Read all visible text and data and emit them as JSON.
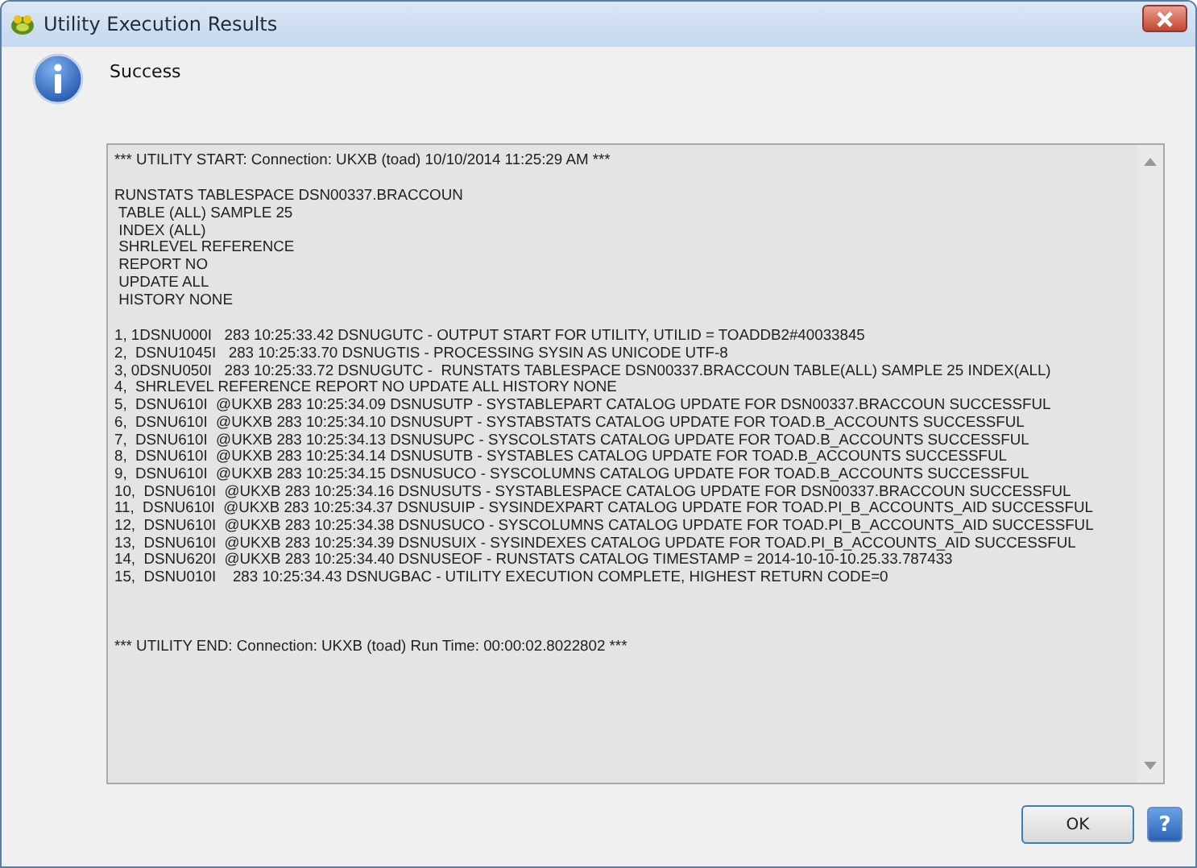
{
  "window": {
    "title": "Utility Execution Results"
  },
  "message": "Success",
  "log": {
    "blocks": [
      {
        "kind": "header",
        "lines": [
          "*** UTILITY START: Connection: UKXB (toad) 10/10/2014 11:25:29 AM ***"
        ]
      },
      {
        "kind": "script",
        "lines": [
          "RUNSTATS TABLESPACE DSN00337.BRACCOUN",
          " TABLE (ALL) SAMPLE 25",
          " INDEX (ALL)",
          " SHRLEVEL REFERENCE",
          " REPORT NO",
          " UPDATE ALL",
          " HISTORY NONE"
        ]
      },
      {
        "kind": "messages",
        "lines": [
          "1, 1DSNU000I   283 10:25:33.42 DSNUGUTC - OUTPUT START FOR UTILITY, UTILID = TOADDB2#40033845",
          "2,  DSNU1045I   283 10:25:33.70 DSNUGTIS - PROCESSING SYSIN AS UNICODE UTF-8",
          "3, 0DSNU050I   283 10:25:33.72 DSNUGUTC -  RUNSTATS TABLESPACE DSN00337.BRACCOUN TABLE(ALL) SAMPLE 25 INDEX(ALL)",
          "4,  SHRLEVEL REFERENCE REPORT NO UPDATE ALL HISTORY NONE",
          "5,  DSNU610I  @UKXB 283 10:25:34.09 DSNUSUTP - SYSTABLEPART CATALOG UPDATE FOR DSN00337.BRACCOUN SUCCESSFUL",
          "6,  DSNU610I  @UKXB 283 10:25:34.10 DSNUSUPT - SYSTABSTATS CATALOG UPDATE FOR TOAD.B_ACCOUNTS SUCCESSFUL",
          "7,  DSNU610I  @UKXB 283 10:25:34.13 DSNUSUPC - SYSCOLSTATS CATALOG UPDATE FOR TOAD.B_ACCOUNTS SUCCESSFUL",
          "8,  DSNU610I  @UKXB 283 10:25:34.14 DSNUSUTB - SYSTABLES CATALOG UPDATE FOR TOAD.B_ACCOUNTS SUCCESSFUL",
          "9,  DSNU610I  @UKXB 283 10:25:34.15 DSNUSUCO - SYSCOLUMNS CATALOG UPDATE FOR TOAD.B_ACCOUNTS SUCCESSFUL",
          "10,  DSNU610I  @UKXB 283 10:25:34.16 DSNUSUTS - SYSTABLESPACE CATALOG UPDATE FOR DSN00337.BRACCOUN SUCCESSFUL",
          "11,  DSNU610I  @UKXB 283 10:25:34.37 DSNUSUIP - SYSINDEXPART CATALOG UPDATE FOR TOAD.PI_B_ACCOUNTS_AID SUCCESSFUL",
          "12,  DSNU610I  @UKXB 283 10:25:34.38 DSNUSUCO - SYSCOLUMNS CATALOG UPDATE FOR TOAD.PI_B_ACCOUNTS_AID SUCCESSFUL",
          "13,  DSNU610I  @UKXB 283 10:25:34.39 DSNUSUIX - SYSINDEXES CATALOG UPDATE FOR TOAD.PI_B_ACCOUNTS_AID SUCCESSFUL",
          "14,  DSNU620I  @UKXB 283 10:25:34.40 DSNUSEOF - RUNSTATS CATALOG TIMESTAMP = 2014-10-10-10.25.33.787433",
          "15,  DSNU010I    283 10:25:34.43 DSNUGBAC - UTILITY EXECUTION COMPLETE, HIGHEST RETURN CODE=0"
        ]
      },
      {
        "kind": "footer",
        "lines": [
          "*** UTILITY END: Connection: UKXB (toad) Run Time: 00:00:02.8022802 ***"
        ]
      }
    ]
  },
  "buttons": [
    {
      "label": "OK",
      "kind": "text"
    },
    {
      "label": "?",
      "kind": "help"
    }
  ]
}
